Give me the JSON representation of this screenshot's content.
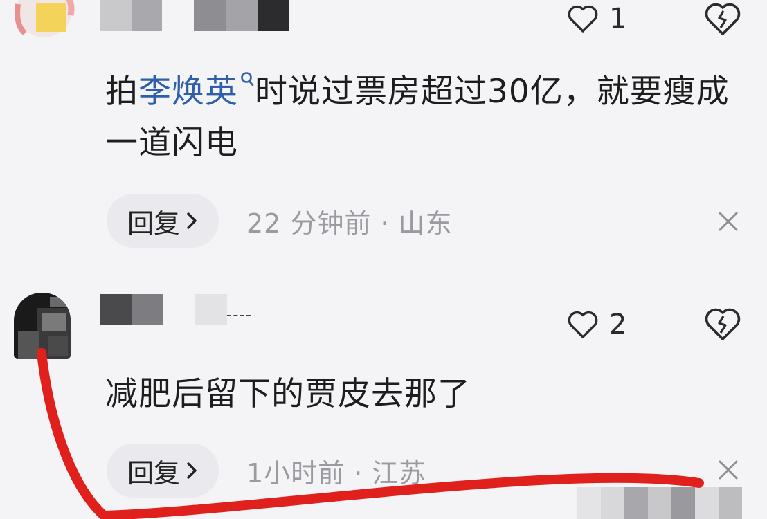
{
  "comments": [
    {
      "likes": "1",
      "text_prefix": "拍",
      "mention": "李焕英",
      "text_rest": "时说过票房超过30亿，就要瘦成一道闪电",
      "reply_label": "回复",
      "meta": "22 分钟前 · 山东"
    },
    {
      "likes": "2",
      "text": "减肥后留下的贾皮去那了",
      "reply_label": "回复",
      "meta": "1小时前 · 江苏"
    }
  ],
  "colors": {
    "background": "#f4f4f6",
    "mention": "#2e5fa8",
    "meta_text": "#9a9aa0",
    "reply_bg": "#e9e9ee",
    "annotation_red": "#e0201c"
  },
  "icons": {
    "like": "heart-outline-icon",
    "dislike": "broken-heart-icon",
    "reply": "chevron-right-icon",
    "close": "close-icon",
    "mention": "search-icon"
  }
}
